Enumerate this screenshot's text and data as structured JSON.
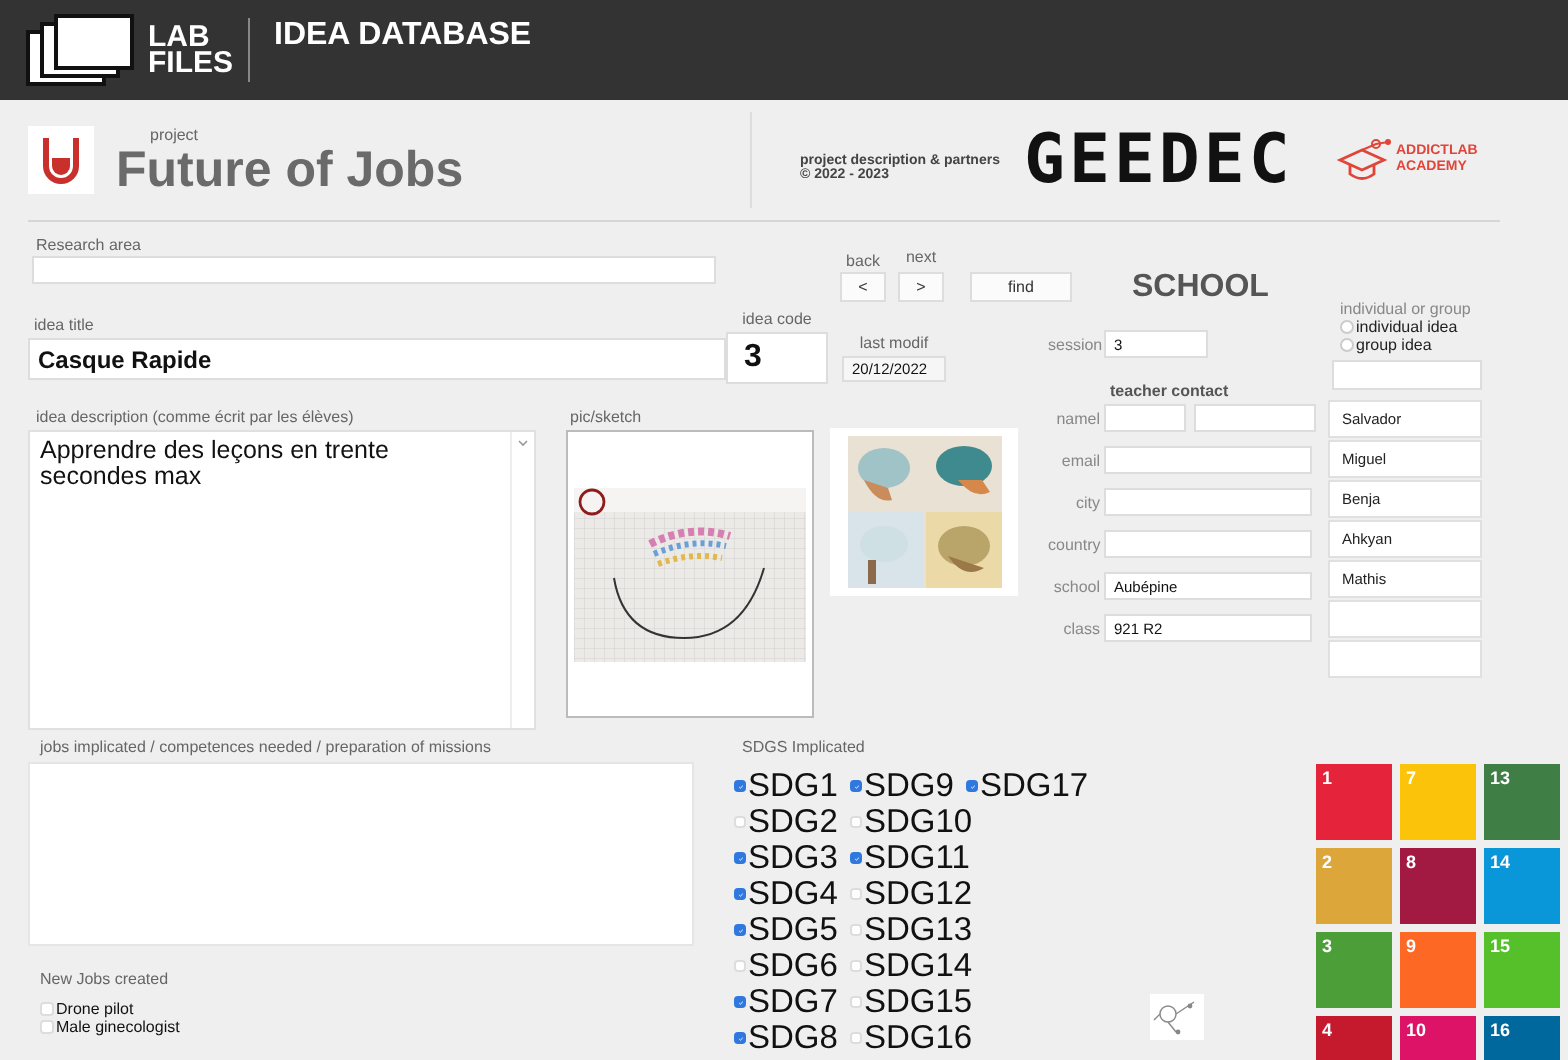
{
  "topbar": {
    "logo_text_1": "LAB",
    "logo_text_2": "FILES",
    "title": "IDEA DATABASE"
  },
  "header": {
    "project_label": "project",
    "project_name": "Future of Jobs",
    "description_line_1": "project description & partners",
    "description_line_2": "© 2022 - 2023",
    "partner_1": "GEEDEC",
    "partner_2_line_1": "ADDICTLAB",
    "partner_2_line_2": "ACADEMY"
  },
  "research_area": {
    "label": "Research area"
  },
  "navigation": {
    "back_label": "back",
    "back_button": "<",
    "next_label": "next",
    "next_button": ">",
    "find_button": "find"
  },
  "idea_title": {
    "label": "idea title",
    "value": "Casque Rapide"
  },
  "idea_code": {
    "label": "idea code",
    "value": "3"
  },
  "last_modif": {
    "label": "last modif",
    "value": "20/12/2022"
  },
  "school_heading": "SCHOOL",
  "session": {
    "label": "session",
    "value": "3"
  },
  "individual_or_group": {
    "label": "individual or group",
    "options": [
      {
        "label": "individual idea",
        "selected": false
      },
      {
        "label": "group idea",
        "selected": false
      }
    ]
  },
  "idea_description": {
    "label": "idea description (comme écrit par les élèves)",
    "value": "Apprendre des leçons en trente secondes max"
  },
  "pic_sketch": {
    "label": "pic/sketch"
  },
  "teacher_contact": {
    "heading": "teacher contact",
    "fields": [
      {
        "label": "namel",
        "kind": "double"
      },
      {
        "label": "email",
        "kind": "single"
      },
      {
        "label": "city",
        "kind": "single"
      },
      {
        "label": "country",
        "kind": "single"
      },
      {
        "label": "school",
        "kind": "single",
        "value": "Aubépine"
      },
      {
        "label": "class",
        "kind": "single",
        "value": "921 R2"
      }
    ]
  },
  "students": [
    "Salvador",
    "Miguel",
    "Benja",
    "Ahkyan",
    "Mathis"
  ],
  "jobs_implicated": {
    "label": "jobs implicated / competences needed / preparation of missions"
  },
  "new_jobs": {
    "label": "New Jobs created",
    "items": [
      {
        "label": "Drone pilot",
        "checked": false
      },
      {
        "label": "Male ginecologist",
        "checked": false
      }
    ]
  },
  "sdgs": {
    "label": "SDGS Implicated",
    "columns": [
      [
        {
          "label": "SDG1",
          "checked": true
        },
        {
          "label": "SDG2",
          "checked": false
        },
        {
          "label": "SDG3",
          "checked": true
        },
        {
          "label": "SDG4",
          "checked": true
        },
        {
          "label": "SDG5",
          "checked": true
        },
        {
          "label": "SDG6",
          "checked": false
        },
        {
          "label": "SDG7",
          "checked": true
        },
        {
          "label": "SDG8",
          "checked": true
        }
      ],
      [
        {
          "label": "SDG9",
          "checked": true
        },
        {
          "label": "SDG10",
          "checked": false
        },
        {
          "label": "SDG11",
          "checked": true
        },
        {
          "label": "SDG12",
          "checked": false
        },
        {
          "label": "SDG13",
          "checked": false
        },
        {
          "label": "SDG14",
          "checked": false
        },
        {
          "label": "SDG15",
          "checked": false
        },
        {
          "label": "SDG16",
          "checked": false
        }
      ],
      [
        {
          "label": "SDG17",
          "checked": true
        }
      ]
    ]
  },
  "sdg_tiles": [
    {
      "number": "1",
      "color": "#e5243b"
    },
    {
      "number": "7",
      "color": "#fcc30b"
    },
    {
      "number": "13",
      "color": "#3f7e44"
    },
    {
      "number": "2",
      "color": "#dda63a"
    },
    {
      "number": "8",
      "color": "#a21942"
    },
    {
      "number": "14",
      "color": "#0a97d9"
    },
    {
      "number": "3",
      "color": "#4c9f38"
    },
    {
      "number": "9",
      "color": "#fd6925"
    },
    {
      "number": "15",
      "color": "#56c02b"
    },
    {
      "number": "4",
      "color": "#c5192d"
    },
    {
      "number": "10",
      "color": "#dd1367"
    },
    {
      "number": "16",
      "color": "#00689d"
    }
  ]
}
